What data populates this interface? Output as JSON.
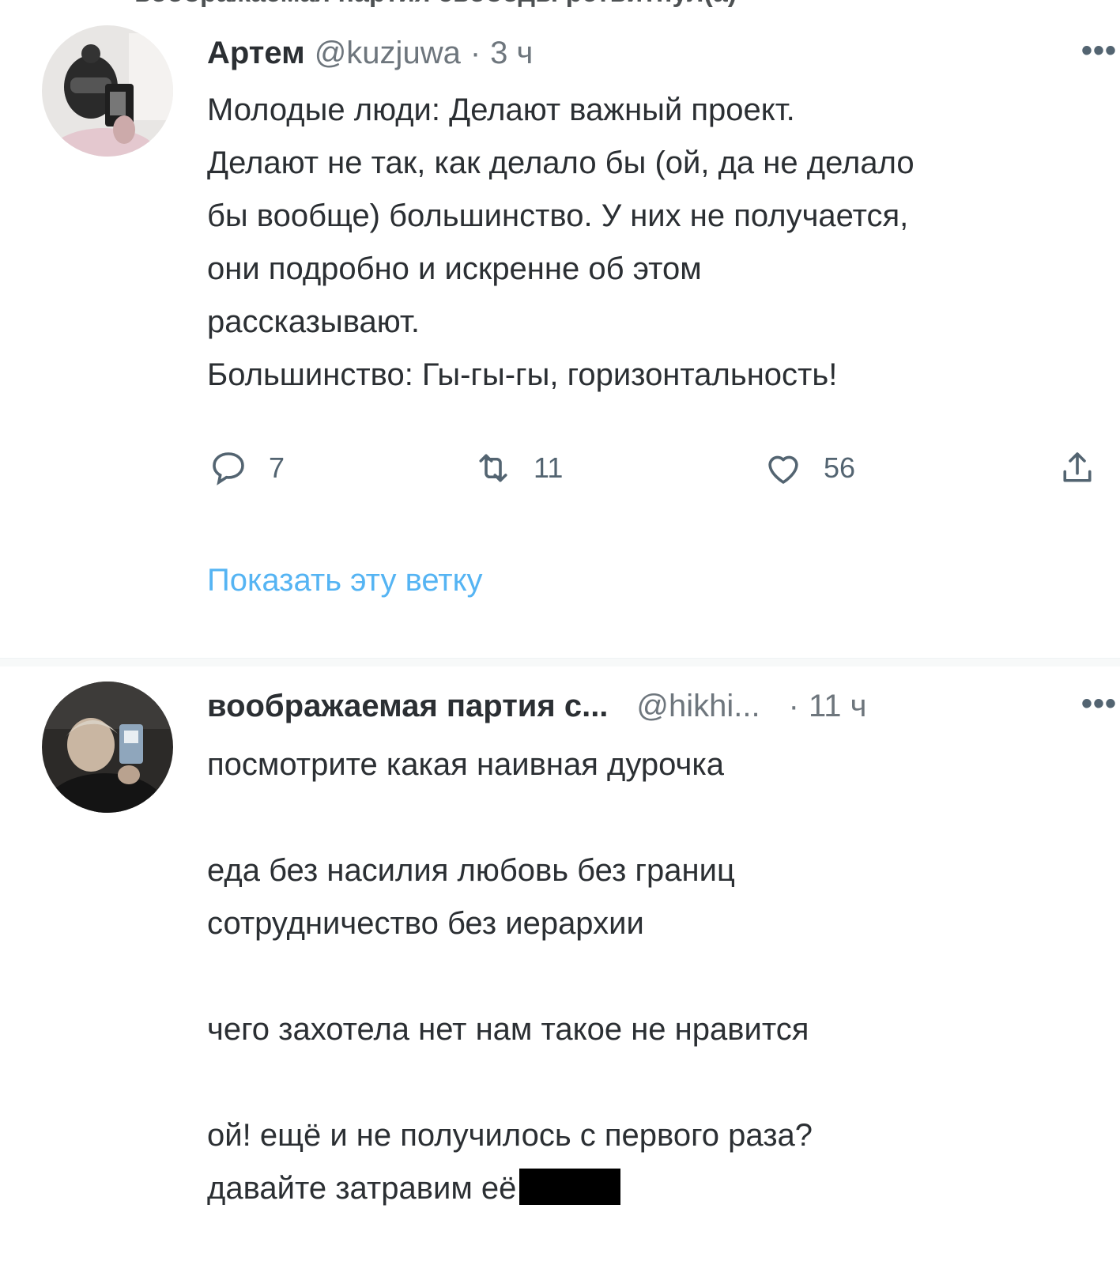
{
  "top_cut_text": "воображаемая партия свободы ретвитнул(а)",
  "tweets": [
    {
      "author": "Артем",
      "handle": "@kuzjuwa",
      "separator": "·",
      "time": "3 ч",
      "more": "•••",
      "lines": [
        "Молодые люди: Делают важный проект.",
        "Делают не так, как делало бы (ой, да не делало",
        "бы вообще) большинство. У них не получается,",
        "они подробно и искренне об этом",
        "рассказывают.",
        "Большинство: Гы-гы-гы, горизонтальность!"
      ],
      "actions": {
        "reply_count": "7",
        "retweet_count": "11",
        "like_count": "56"
      },
      "show_thread": "Показать эту ветку"
    },
    {
      "author": "воображаемая партия с...",
      "handle": "@hikhi...",
      "separator": "·",
      "time": "11 ч",
      "more": "•••",
      "lines": [
        "посмотрите какая наивная дурочка",
        "",
        "еда без насилия любовь без границ",
        "сотрудничество без иерархии",
        "",
        "чего захотела нет нам такое не нравится",
        "",
        "ой! ещё и не получилось с первого раза?",
        "давайте затравим её "
      ]
    }
  ],
  "colors": {
    "text": "#2b2f33",
    "secondary": "#6e767d",
    "link": "#1d9bf0",
    "divider": "#f7f9f9"
  }
}
